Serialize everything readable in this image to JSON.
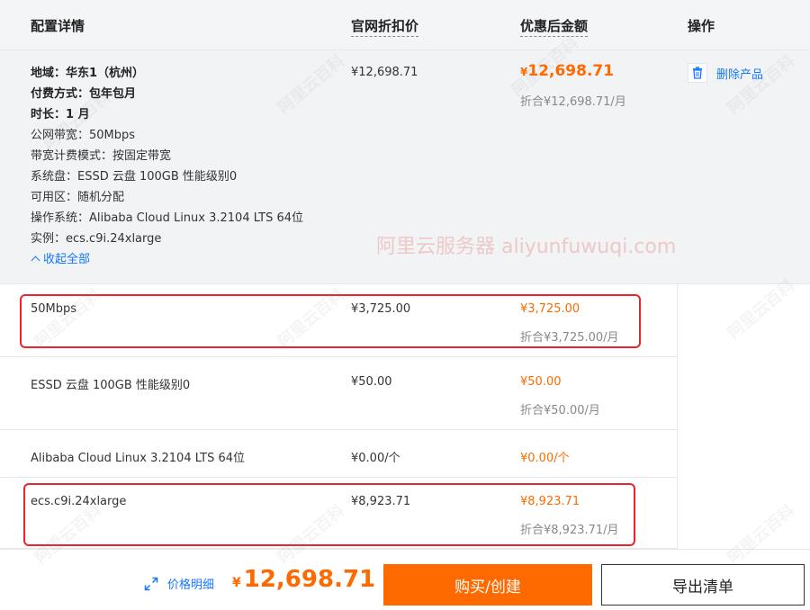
{
  "header": {
    "col_config": "配置详情",
    "col_official": "官网折扣价",
    "col_discount": "优惠后金额",
    "col_action": "操作"
  },
  "main": {
    "details": [
      {
        "text": "地域：华东1（杭州）",
        "strong": true
      },
      {
        "text": "付费方式：包年包月",
        "strong": true
      },
      {
        "text": "时长：1 月",
        "strong": true
      },
      {
        "text": "公网带宽：50Mbps",
        "strong": false
      },
      {
        "text": "带宽计费模式：按固定带宽",
        "strong": false
      },
      {
        "text": "系统盘：ESSD 云盘 100GB 性能级别0",
        "strong": false
      },
      {
        "text": "可用区：随机分配",
        "strong": false
      },
      {
        "text": "操作系统：Alibaba Cloud Linux 3.2104 LTS 64位",
        "strong": false
      },
      {
        "text": "实例：ecs.c9i.24xlarge",
        "strong": false
      }
    ],
    "collapse_label": "收起全部",
    "official_price": "¥12,698.71",
    "discount_yen": "¥",
    "discount_amount": "12,698.71",
    "discount_sub": "折合¥12,698.71/月",
    "delete_label": "删除产品"
  },
  "items": [
    {
      "name": "50Mbps",
      "official": "¥3,725.00",
      "discount": "¥3,725.00",
      "sub": "折合¥3,725.00/月"
    },
    {
      "name": "ESSD 云盘 100GB 性能级别0",
      "official": "¥50.00",
      "discount": "¥50.00",
      "sub": "折合¥50.00/月"
    },
    {
      "name": "Alibaba Cloud Linux 3.2104 LTS 64位",
      "official": "¥0.00/个",
      "discount": "¥0.00/个",
      "sub": ""
    },
    {
      "name": "ecs.c9i.24xlarge",
      "official": "¥8,923.71",
      "discount": "¥8,923.71",
      "sub": "折合¥8,923.71/月"
    }
  ],
  "footer": {
    "price_detail_label": "价格明细",
    "total_yen": "¥",
    "total_amount": "12,698.71",
    "buy_label": "购买/创建",
    "export_label": "导出清单"
  },
  "watermark": {
    "text": "阿里云服务器 aliyunfuwuqi.com",
    "diag": "阿里云百科"
  },
  "colors": {
    "accent_orange": "#ff6a00",
    "link_blue": "#1677ff",
    "highlight_red": "#e8262b"
  }
}
